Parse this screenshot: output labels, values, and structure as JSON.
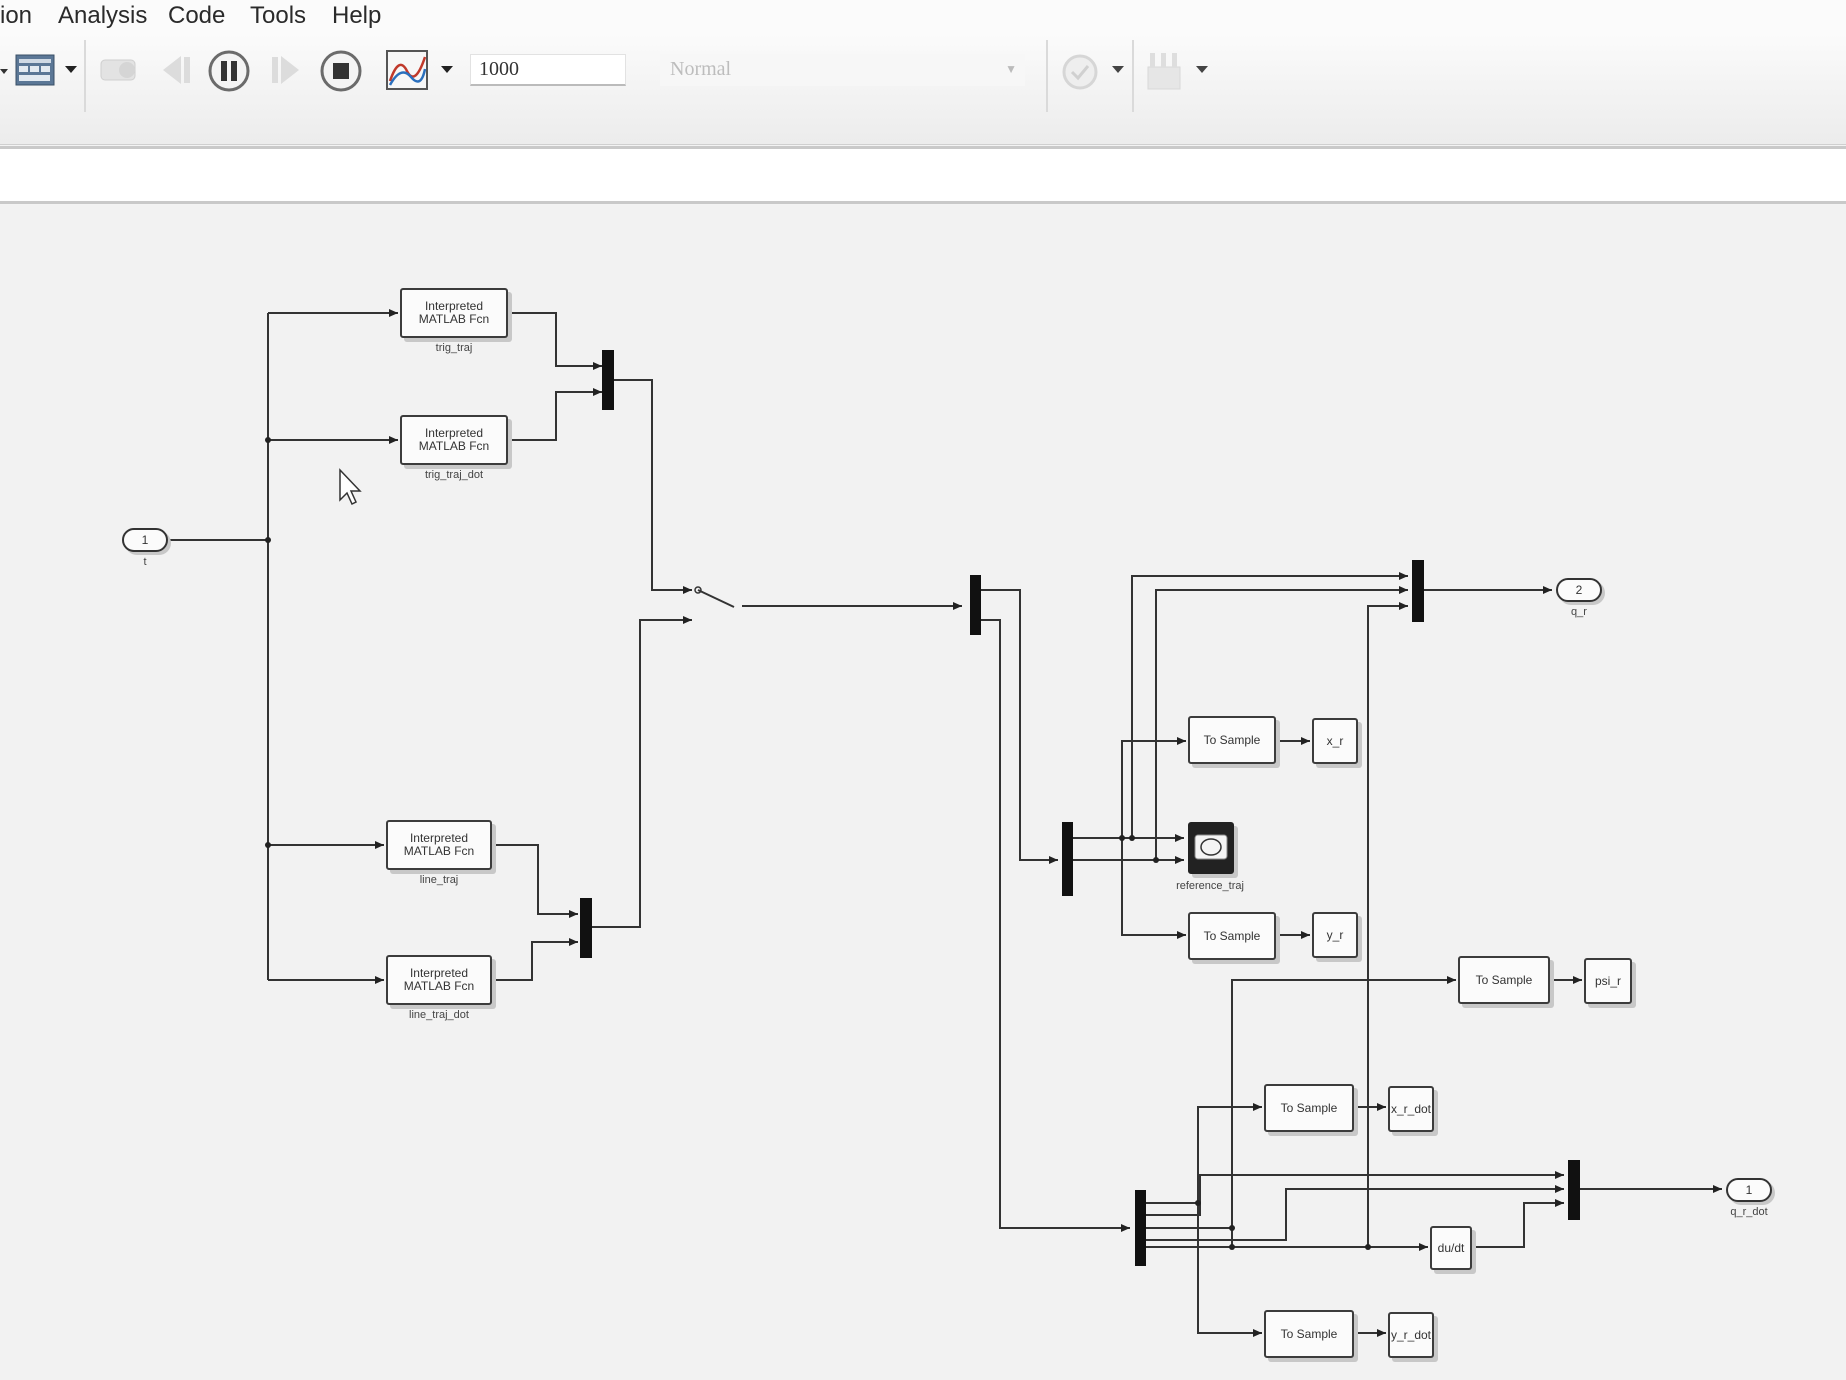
{
  "menu": {
    "items": [
      "ion",
      "Analysis",
      "Code",
      "Tools",
      "Help"
    ]
  },
  "toolbar": {
    "stop_time": "1000",
    "sim_mode": "Normal",
    "icons": [
      "model-config-icon",
      "step-back-icon",
      "pause-icon",
      "step-forward-icon",
      "stop-icon",
      "data-inspector-icon",
      "check-icon",
      "build-icon"
    ]
  },
  "model": {
    "inports": [
      {
        "number": "1",
        "label": "t"
      }
    ],
    "outports": [
      {
        "number": "2",
        "label": "q_r"
      },
      {
        "number": "1",
        "label": "q_r_dot"
      }
    ],
    "fcn_blocks": [
      {
        "text": "Interpreted MATLAB Fcn",
        "label": "trig_traj"
      },
      {
        "text": "Interpreted MATLAB Fcn",
        "label": "trig_traj_dot"
      },
      {
        "text": "Interpreted MATLAB Fcn",
        "label": "line_traj"
      },
      {
        "text": "Interpreted MATLAB Fcn",
        "label": "line_traj_dot"
      }
    ],
    "to_sample": "To Sample",
    "workspace_vars": [
      "x_r",
      "y_r",
      "psi_r",
      "x_r_dot",
      "y_r_dot"
    ],
    "scope_label": "reference_traj",
    "derivative": "du/dt"
  }
}
